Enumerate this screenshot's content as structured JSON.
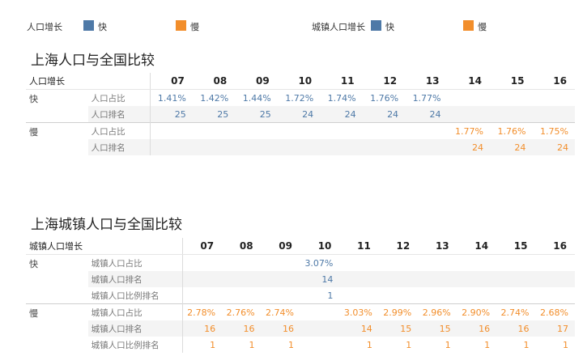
{
  "legend": {
    "group1_title": "人口增长",
    "group2_title": "城镇人口增长",
    "fast_label": "快",
    "slow_label": "慢",
    "fast_color": "#4e79a7",
    "slow_color": "#f28e2b"
  },
  "table1": {
    "title": "上海人口与全国比较",
    "row_header": "人口增长",
    "columns": [
      "07",
      "08",
      "09",
      "10",
      "11",
      "12",
      "13",
      "14",
      "15",
      "16"
    ],
    "groups": [
      {
        "label": "快",
        "color": "blue",
        "rows": [
          {
            "measure": "人口占比",
            "values": [
              "1.41%",
              "1.42%",
              "1.44%",
              "1.72%",
              "1.74%",
              "1.76%",
              "1.77%",
              "",
              "",
              ""
            ]
          },
          {
            "measure": "人口排名",
            "values": [
              "25",
              "25",
              "25",
              "24",
              "24",
              "24",
              "24",
              "",
              "",
              ""
            ]
          }
        ]
      },
      {
        "label": "慢",
        "color": "orange",
        "rows": [
          {
            "measure": "人口占比",
            "values": [
              "",
              "",
              "",
              "",
              "",
              "",
              "",
              "1.77%",
              "1.76%",
              "1.75%"
            ]
          },
          {
            "measure": "人口排名",
            "values": [
              "",
              "",
              "",
              "",
              "",
              "",
              "",
              "24",
              "24",
              "24"
            ]
          }
        ]
      }
    ]
  },
  "table2": {
    "title": "上海城镇人口与全国比较",
    "row_header": "城镇人口增长",
    "columns": [
      "07",
      "08",
      "09",
      "10",
      "11",
      "12",
      "13",
      "14",
      "15",
      "16"
    ],
    "groups": [
      {
        "label": "快",
        "color": "blue",
        "rows": [
          {
            "measure": "城镇人口占比",
            "values": [
              "",
              "",
              "",
              "3.07%",
              "",
              "",
              "",
              "",
              "",
              ""
            ]
          },
          {
            "measure": "城镇人口排名",
            "values": [
              "",
              "",
              "",
              "14",
              "",
              "",
              "",
              "",
              "",
              ""
            ]
          },
          {
            "measure": "城镇人口比例排名",
            "values": [
              "",
              "",
              "",
              "1",
              "",
              "",
              "",
              "",
              "",
              ""
            ]
          }
        ]
      },
      {
        "label": "慢",
        "color": "orange",
        "rows": [
          {
            "measure": "城镇人口占比",
            "values": [
              "2.78%",
              "2.76%",
              "2.74%",
              "",
              "3.03%",
              "2.99%",
              "2.96%",
              "2.90%",
              "2.74%",
              "2.68%"
            ]
          },
          {
            "measure": "城镇人口排名",
            "values": [
              "16",
              "16",
              "16",
              "",
              "14",
              "15",
              "15",
              "16",
              "16",
              "17"
            ]
          },
          {
            "measure": "城镇人口比例排名",
            "values": [
              "1",
              "1",
              "1",
              "",
              "1",
              "1",
              "1",
              "1",
              "1",
              "1"
            ]
          }
        ]
      }
    ]
  }
}
